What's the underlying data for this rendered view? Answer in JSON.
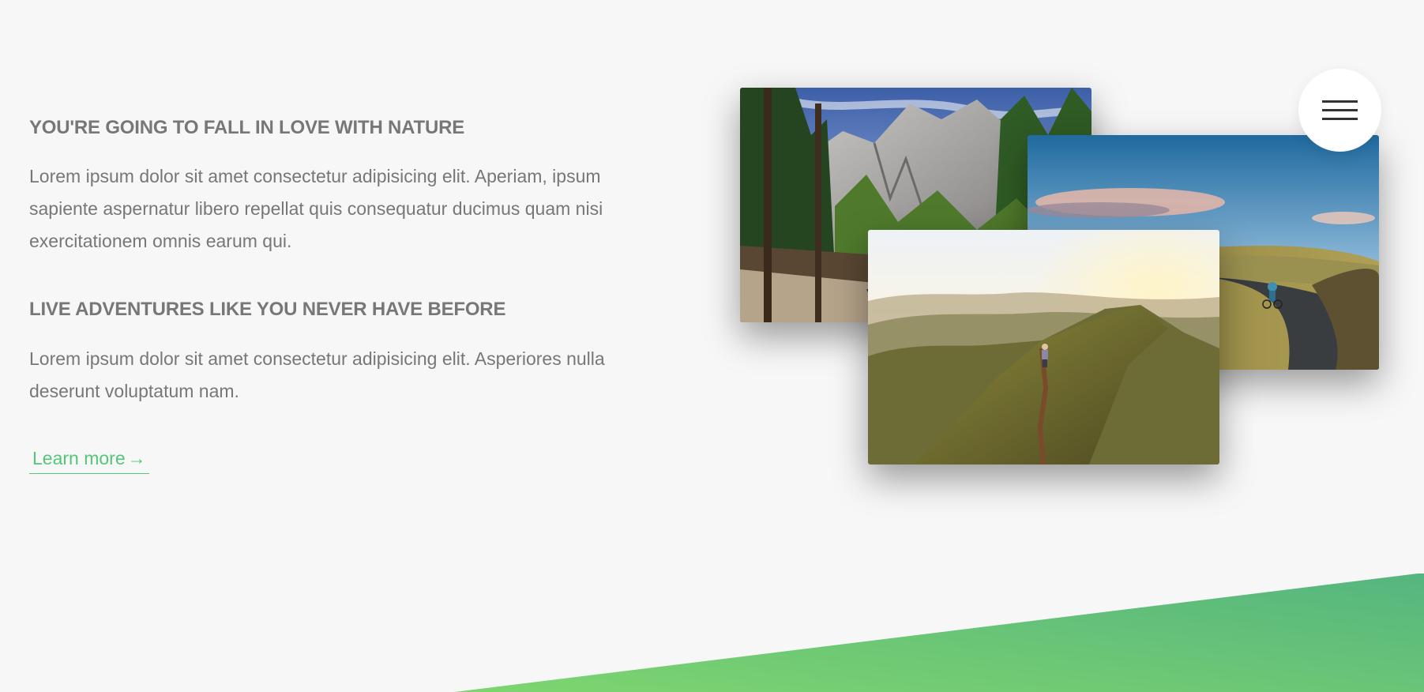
{
  "about": {
    "heading_1": "YOU'RE GOING TO FALL IN LOVE WITH NATURE",
    "paragraph_1": "Lorem ipsum dolor sit amet consectetur adipisicing elit. Aperiam, ipsum sapiente aspernatur libero repellat quis consequatur ducimus quam nisi exercitationem omnis earum qui.",
    "heading_2": "LIVE ADVENTURES LIKE YOU NEVER HAVE BEFORE",
    "paragraph_2": "Lorem ipsum dolor sit amet consectetur adipisicing elit. Asperiores nulla deserunt voluptatum nam.",
    "learn_more_label": "Learn more",
    "learn_more_arrow": "→"
  },
  "icons": {
    "nav": "hamburger-menu-icon"
  },
  "colors": {
    "accent_green": "#55c57a",
    "accent_green_light": "#7ed56f",
    "text_grey": "#777777",
    "background": "#f7f7f7"
  }
}
